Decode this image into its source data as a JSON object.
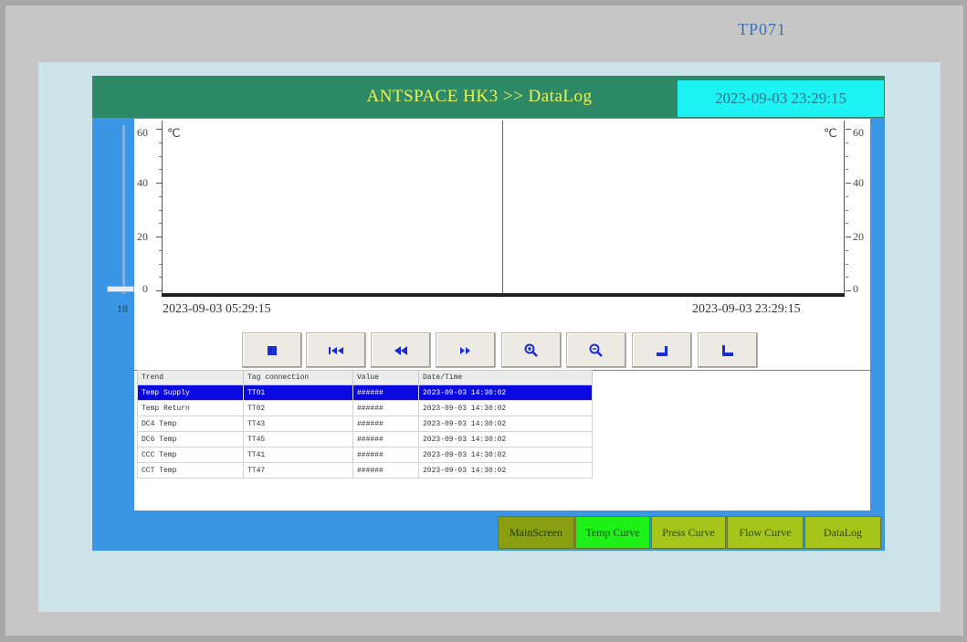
{
  "device": {
    "label": "TP071"
  },
  "header": {
    "title": "ANTSPACE HK3 >> DataLog",
    "datetime": "2023-09-03 23:29:15"
  },
  "chart": {
    "unit_left": "℃",
    "unit_right": "℃",
    "left_ticks": [
      "60",
      "40",
      "20",
      "0"
    ],
    "right_ticks": [
      "60",
      "40",
      "20",
      "0"
    ],
    "time_start": "2023-09-03 05:29:15",
    "time_end": "2023-09-03 23:29:15",
    "slider_value": "18"
  },
  "chart_data": {
    "type": "line",
    "ylim": [
      0,
      60
    ],
    "y_ticks": [
      0,
      20,
      40,
      60
    ],
    "x_range": [
      "2023-09-03 05:29:15",
      "2023-09-03 23:29:15"
    ],
    "series": []
  },
  "controls": [
    {
      "name": "stop-icon"
    },
    {
      "name": "skip-back-icon"
    },
    {
      "name": "rewind-icon"
    },
    {
      "name": "fast-forward-icon"
    },
    {
      "name": "zoom-in-icon"
    },
    {
      "name": "zoom-out-icon"
    },
    {
      "name": "ruler-left-icon"
    },
    {
      "name": "ruler-right-icon"
    }
  ],
  "table": {
    "headers": [
      "Trend",
      "Tag connection",
      "Value",
      "Date/Time"
    ],
    "rows": [
      {
        "trend": "Temp Supply",
        "tag": "TT01",
        "value": "######",
        "datetime": "2023-09-03 14:30:02"
      },
      {
        "trend": "Temp Return",
        "tag": "TT02",
        "value": "######",
        "datetime": "2023-09-03 14:30:02"
      },
      {
        "trend": "DC4 Temp",
        "tag": "TT43",
        "value": "######",
        "datetime": "2023-09-03 14:30:02"
      },
      {
        "trend": "DC6 Temp",
        "tag": "TT45",
        "value": "######",
        "datetime": "2023-09-03 14:30:02"
      },
      {
        "trend": "CCC Temp",
        "tag": "TT41",
        "value": "######",
        "datetime": "2023-09-03 14:30:02"
      },
      {
        "trend": "CCT Temp",
        "tag": "TT47",
        "value": "######",
        "datetime": "2023-09-03 14:30:02"
      }
    ]
  },
  "nav": [
    {
      "label": "MainScreen",
      "color": "#8a9e12",
      "text": "#1b3a0a"
    },
    {
      "label": "Temp Curve",
      "color": "#1ef01a",
      "text": "#234d12"
    },
    {
      "label": "Press Curve",
      "color": "#a6c41a",
      "text": "#2d4a10"
    },
    {
      "label": "Flow Curve",
      "color": "#a6c41a",
      "text": "#2d4a10"
    },
    {
      "label": "DataLog",
      "color": "#a6c41a",
      "text": "#2d4a10"
    }
  ],
  "colors": {
    "title_bar": "#2e8a66",
    "title_text": "#eaf35a",
    "datetime_bg": "#1df2f4",
    "panel": "#3b96e6",
    "selection": "#0a0ae0"
  }
}
